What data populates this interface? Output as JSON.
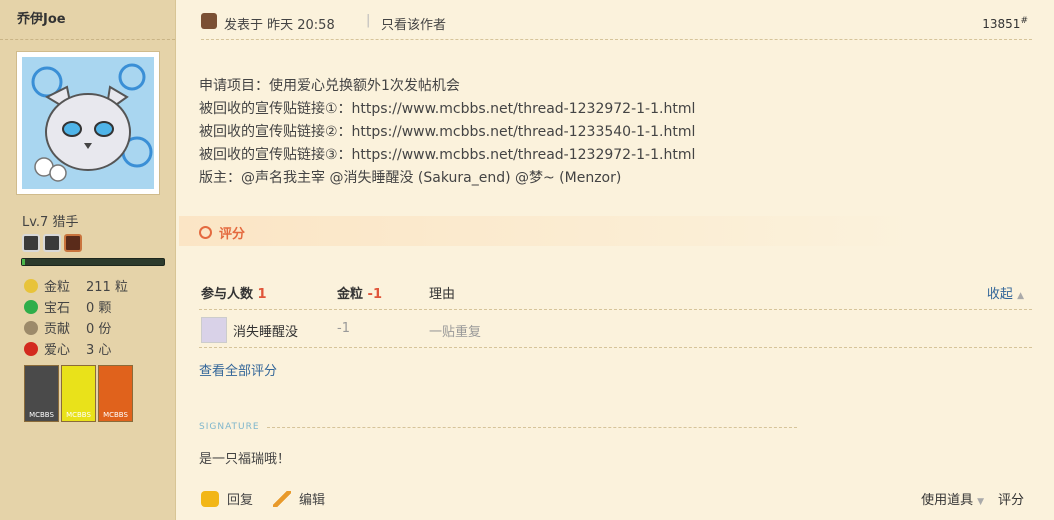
{
  "author": {
    "name": "乔伊Joe"
  },
  "profile": {
    "level": "Lv.7 猎手",
    "stats": [
      {
        "icon": "gold-nugget-icon",
        "name": "金粒",
        "value": "211 粒",
        "color": "#e8c33a"
      },
      {
        "icon": "emerald-icon",
        "name": "宝石",
        "value": "0 颗",
        "color": "#2fae4a"
      },
      {
        "icon": "contribution-icon",
        "name": "贡献",
        "value": "0 份",
        "color": "#9c8a6a"
      },
      {
        "icon": "heart-apple-icon",
        "name": "爱心",
        "value": "3 心",
        "color": "#d32a1e"
      }
    ],
    "exp_progress": 0.02,
    "medals": [
      {
        "label": "MCBBS",
        "color": "#4a4a4a"
      },
      {
        "label": "MCBBS",
        "color": "#e9e21a"
      },
      {
        "label": "MCBBS",
        "color": "#e0621c"
      }
    ]
  },
  "post": {
    "posted_label": "发表于 昨天 20:58",
    "separator": "|",
    "only_author": "只看该作者",
    "floor": "13851",
    "floor_mark": "#",
    "lines": [
      "申请项目：使用爱心兑换额外1次发帖机会",
      "被回收的宣传贴链接①：https://www.mcbbs.net/thread-1232972-1-1.html",
      "被回收的宣传贴链接②：https://www.mcbbs.net/thread-1233540-1-1.html",
      "被回收的宣传贴链接③：https://www.mcbbs.net/thread-1232972-1-1.html",
      "版主：@声名我主宰 @消失睡醒没 (Sakura_end) @梦~ (Menzor)"
    ]
  },
  "rating": {
    "title": "评分",
    "head": {
      "participants": "参与人数",
      "participants_count": "1",
      "gold": "金粒",
      "gold_value": "-1",
      "reason": "理由",
      "collapse": "收起"
    },
    "rows": [
      {
        "user": "消失睡醒没",
        "gold": "-1",
        "reason": "一贴重复"
      }
    ],
    "view_all": "查看全部评分"
  },
  "signature": {
    "label": "SIGNATURE",
    "text": "是一只福瑞哦！"
  },
  "actions": {
    "reply": "回复",
    "edit": "编辑",
    "tools": "使用道具",
    "rate": "评分"
  }
}
